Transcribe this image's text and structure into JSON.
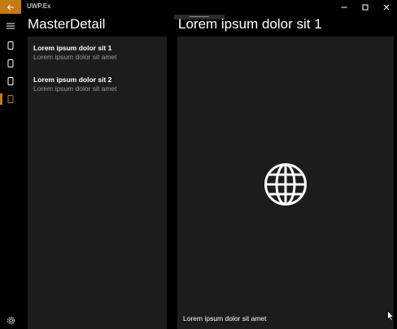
{
  "window": {
    "title": "UWP.Ex",
    "controls": [
      "minimize-icon",
      "maximize-icon",
      "close-icon"
    ]
  },
  "back_button": {
    "icon": "back-arrow-icon"
  },
  "nav": {
    "menu_icon": "hamburger-icon",
    "items": [
      {
        "icon": "page-icon",
        "active": false
      },
      {
        "icon": "page-icon",
        "active": false
      },
      {
        "icon": "page-icon",
        "active": false
      },
      {
        "icon": "page-icon",
        "active": true
      }
    ],
    "settings_icon": "gear-icon"
  },
  "master": {
    "title": "MasterDetail",
    "items": [
      {
        "title": "Lorem ipsum dolor sit 1",
        "subtitle": "Lorem ipsum dolor sit amet"
      },
      {
        "title": "Lorem ipsum dolor sit 2",
        "subtitle": "Lorem ipsum dolor sit amet"
      }
    ]
  },
  "detail": {
    "title": "Lorem ipsum dolor sit 1",
    "icon": "globe-icon",
    "caption": "Lorem ipsum dolor sit amet"
  },
  "colors": {
    "accent": "#c77a12",
    "background": "#000000",
    "panel": "#1c1c1c",
    "secondary_text": "#9a9a9a"
  }
}
